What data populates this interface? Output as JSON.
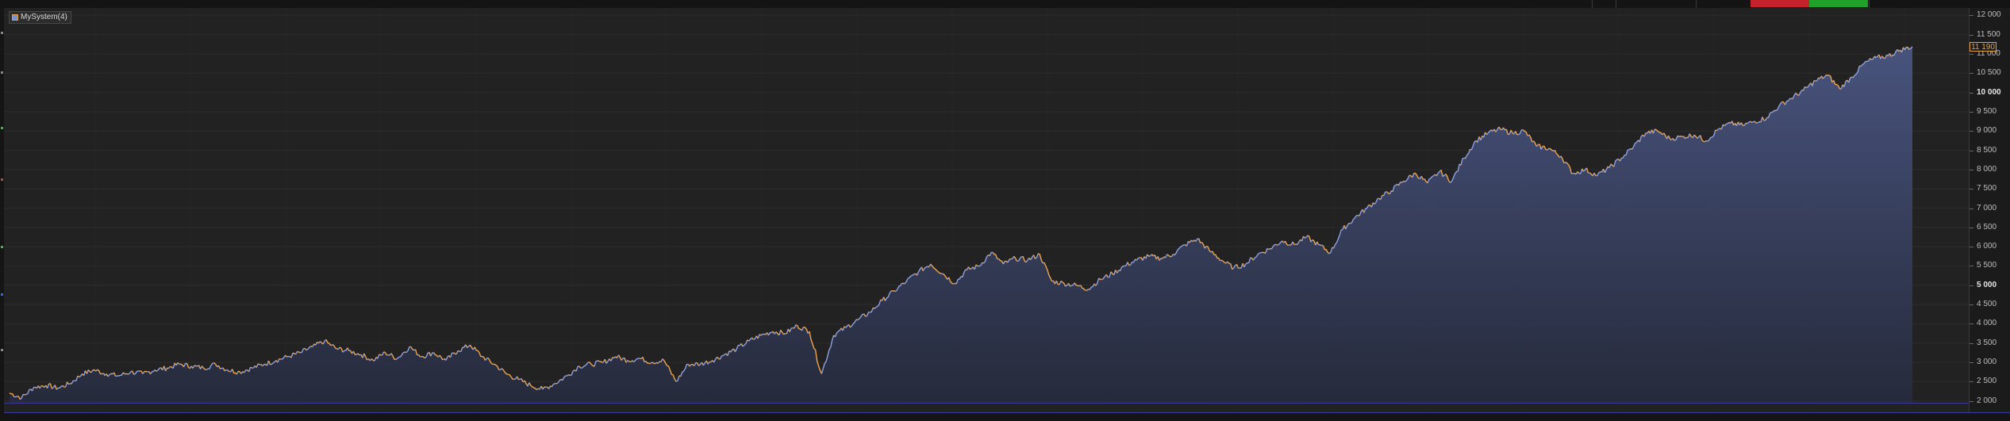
{
  "series_label": "MySystem(4)",
  "last_value_label": "11 190",
  "colors": {
    "background": "#1c1c1c",
    "plot_background": "#222222",
    "grid": "#2c2c2c",
    "line_up": "#8fa0e0",
    "line_down": "#f0a54a",
    "area_top": "#4a5682",
    "area_bottom": "#262b3e",
    "badge": "#e3a245",
    "top_red": "#c4232b",
    "top_green": "#1fa12a"
  },
  "chart_data": {
    "type": "area",
    "series": [
      {
        "name": "MySystem(4)",
        "values": [
          2200,
          2080,
          2350,
          2400,
          2330,
          2450,
          2700,
          2800,
          2700,
          2650,
          2750,
          2700,
          2800,
          2850,
          2950,
          2900,
          2850,
          2950,
          2800,
          2750,
          2850,
          2950,
          3050,
          3150,
          3250,
          3400,
          3550,
          3350,
          3300,
          3200,
          3050,
          3250,
          3100,
          3400,
          3150,
          3250,
          3050,
          3300,
          3450,
          3150,
          2950,
          2700,
          2550,
          2400,
          2300,
          2450,
          2650,
          2900,
          2950,
          3000,
          3150,
          3050,
          3100,
          3000,
          3050,
          2500,
          2950,
          2950,
          3050,
          3200,
          3350,
          3550,
          3700,
          3800,
          3750,
          3950,
          3800,
          2700,
          3700,
          3900,
          4100,
          4300,
          4600,
          4850,
          5100,
          5350,
          5550,
          5300,
          5050,
          5400,
          5500,
          5850,
          5550,
          5700,
          5650,
          5800,
          5100,
          5050,
          5000,
          4900,
          5150,
          5300,
          5500,
          5650,
          5750,
          5700,
          5800,
          6050,
          6200,
          5900,
          5650,
          5450,
          5550,
          5800,
          5950,
          6150,
          6050,
          6250,
          6050,
          5850,
          6450,
          6750,
          7000,
          7250,
          7450,
          7700,
          7900,
          7650,
          7950,
          7700,
          8300,
          8750,
          8950,
          9050,
          8950,
          9000,
          8600,
          8550,
          8350,
          7900,
          8000,
          7850,
          8050,
          8300,
          8600,
          8950,
          9000,
          8800,
          8850,
          8900,
          8750,
          9050,
          9200,
          9150,
          9250,
          9350,
          9650,
          9850,
          10050,
          10300,
          10450,
          10100,
          10400,
          10750,
          10900,
          10950,
          11100,
          11190
        ]
      }
    ],
    "ylim": [
      1950,
      12050
    ],
    "yticks": [
      {
        "value": 12000,
        "label": "12 000",
        "major": false
      },
      {
        "value": 11500,
        "label": "11 500",
        "major": false
      },
      {
        "value": 11000,
        "label": "11 000",
        "major": false
      },
      {
        "value": 10500,
        "label": "10 500",
        "major": false
      },
      {
        "value": 10000,
        "label": "10 000",
        "major": true
      },
      {
        "value": 9500,
        "label": "9 500",
        "major": false
      },
      {
        "value": 9000,
        "label": "9 000",
        "major": false
      },
      {
        "value": 8500,
        "label": "8 500",
        "major": false
      },
      {
        "value": 8000,
        "label": "8 000",
        "major": false
      },
      {
        "value": 7500,
        "label": "7 500",
        "major": false
      },
      {
        "value": 7000,
        "label": "7 000",
        "major": false
      },
      {
        "value": 6500,
        "label": "6 500",
        "major": false
      },
      {
        "value": 6000,
        "label": "6 000",
        "major": false
      },
      {
        "value": 5500,
        "label": "5 500",
        "major": false
      },
      {
        "value": 5000,
        "label": "5 000",
        "major": true
      },
      {
        "value": 4500,
        "label": "4 500",
        "major": false
      },
      {
        "value": 4000,
        "label": "4 000",
        "major": false
      },
      {
        "value": 3500,
        "label": "3 500",
        "major": false
      },
      {
        "value": 3000,
        "label": "3 000",
        "major": false
      },
      {
        "value": 2500,
        "label": "2 500",
        "major": false
      },
      {
        "value": 2000,
        "label": "2 000",
        "major": false
      }
    ],
    "grid": true,
    "legend": "top-left",
    "last_value": 11190
  }
}
